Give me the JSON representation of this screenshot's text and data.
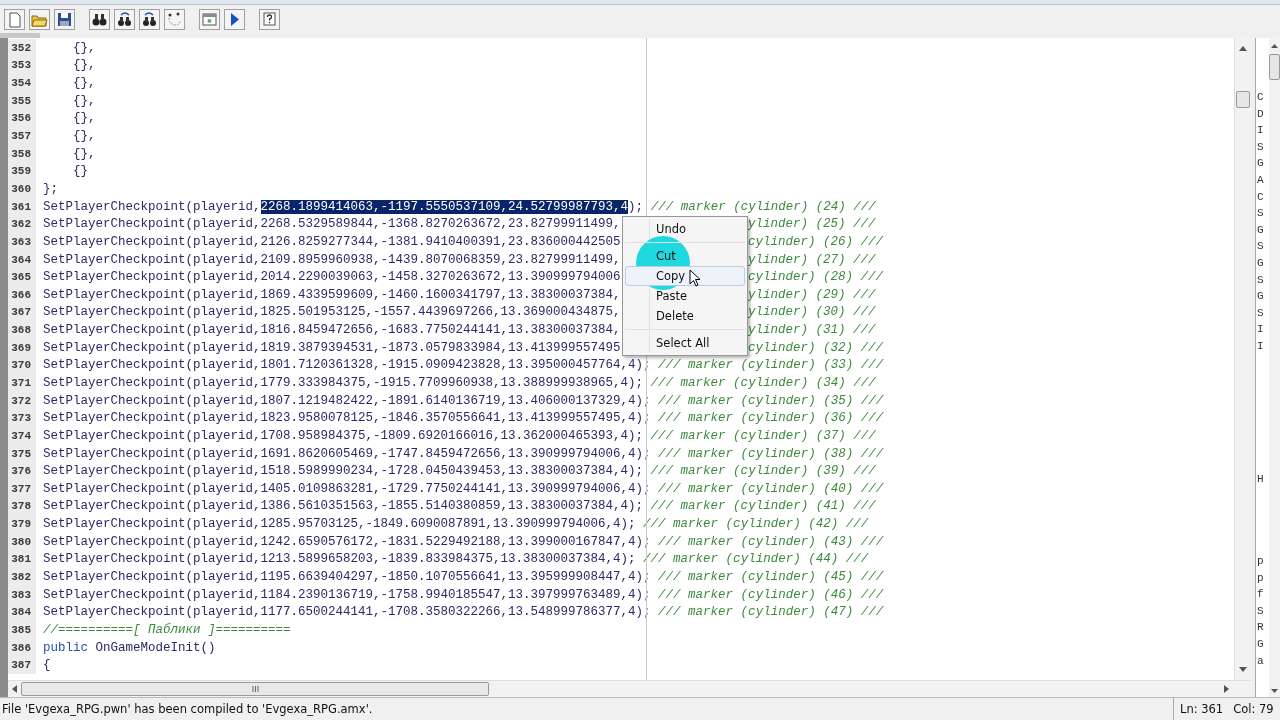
{
  "editor": {
    "lines": [
      {
        "number": "352",
        "parts": [
          {
            "kind": "code",
            "text": "    {},"
          }
        ]
      },
      {
        "number": "353",
        "parts": [
          {
            "kind": "code",
            "text": "    {},"
          }
        ]
      },
      {
        "number": "354",
        "parts": [
          {
            "kind": "code",
            "text": "    {},"
          }
        ]
      },
      {
        "number": "355",
        "parts": [
          {
            "kind": "code",
            "text": "    {},"
          }
        ]
      },
      {
        "number": "356",
        "parts": [
          {
            "kind": "code",
            "text": "    {},"
          }
        ]
      },
      {
        "number": "357",
        "parts": [
          {
            "kind": "code",
            "text": "    {},"
          }
        ]
      },
      {
        "number": "358",
        "parts": [
          {
            "kind": "code",
            "text": "    {},"
          }
        ]
      },
      {
        "number": "359",
        "parts": [
          {
            "kind": "code",
            "text": "    {}"
          }
        ]
      },
      {
        "number": "360",
        "parts": [
          {
            "kind": "code",
            "text": "};"
          }
        ]
      },
      {
        "number": "361",
        "parts": [
          {
            "kind": "code",
            "text": "SetPlayerCheckpoint(playerid,"
          },
          {
            "kind": "selected",
            "text": "2268.1899414063,-1197.5550537109,24.52799987793,4"
          },
          {
            "kind": "code",
            "text": "); "
          },
          {
            "kind": "comment",
            "text": "/// marker (cylinder) (24) ///"
          }
        ]
      },
      {
        "number": "362",
        "parts": [
          {
            "kind": "code",
            "text": "SetPlayerCheckpoint(playerid,2268.5329589844,-1368.8270263672,23.82799911499,"
          }
        ],
        "tail": [
          {
            "kind": "comment",
            "text": "ylinder) (25) ///"
          }
        ]
      },
      {
        "number": "363",
        "parts": [
          {
            "kind": "code",
            "text": "SetPlayerCheckpoint(playerid,2126.8259277344,-1381.9410400391,23.836000442505"
          }
        ],
        "tail": [
          {
            "kind": "comment",
            "text": "cylinder) (26) ///"
          }
        ]
      },
      {
        "number": "364",
        "parts": [
          {
            "kind": "code",
            "text": "SetPlayerCheckpoint(playerid,2109.8959960938,-1439.8070068359,23.82799911499,"
          }
        ],
        "tail": [
          {
            "kind": "comment",
            "text": "ylinder) (27) ///"
          }
        ]
      },
      {
        "number": "365",
        "parts": [
          {
            "kind": "code",
            "text": "SetPlayerCheckpoint(playerid,2014.2290039063,-1458.3270263672,13.390999794006"
          }
        ],
        "tail": [
          {
            "kind": "comment",
            "text": "cylinder) (28) ///"
          }
        ]
      },
      {
        "number": "366",
        "parts": [
          {
            "kind": "code",
            "text": "SetPlayerCheckpoint(playerid,1869.4339599609,-1460.1600341797,13.38300037384,"
          }
        ],
        "tail": [
          {
            "kind": "comment",
            "text": "ylinder) (29) ///"
          }
        ]
      },
      {
        "number": "367",
        "parts": [
          {
            "kind": "code",
            "text": "SetPlayerCheckpoint(playerid,1825.501953125,-1557.4439697266,13.369000434875,"
          }
        ],
        "tail": [
          {
            "kind": "comment",
            "text": "ylinder) (30) ///"
          }
        ]
      },
      {
        "number": "368",
        "parts": [
          {
            "kind": "code",
            "text": "SetPlayerCheckpoint(playerid,1816.8459472656,-1683.7750244141,13.38300037384,"
          }
        ],
        "tail": [
          {
            "kind": "comment",
            "text": "ylinder) (31) ///"
          }
        ]
      },
      {
        "number": "369",
        "parts": [
          {
            "kind": "code",
            "text": "SetPlayerCheckpoint(playerid,1819.3879394531,-1873.0579833984,13.413999557495"
          }
        ],
        "tail": [
          {
            "kind": "comment",
            "text": "cylinder) (32) ///"
          }
        ]
      },
      {
        "number": "370",
        "parts": [
          {
            "kind": "code",
            "text": "SetPlayerCheckpoint(playerid,1801.7120361328,-1915.0909423828,13.395000457764,4); "
          },
          {
            "kind": "comment",
            "text": "/// marker (cylinder) (33) ///"
          }
        ]
      },
      {
        "number": "371",
        "parts": [
          {
            "kind": "code",
            "text": "SetPlayerCheckpoint(playerid,1779.333984375,-1915.7709960938,13.388999938965,4); "
          },
          {
            "kind": "comment",
            "text": "/// marker (cylinder) (34) ///"
          }
        ]
      },
      {
        "number": "372",
        "parts": [
          {
            "kind": "code",
            "text": "SetPlayerCheckpoint(playerid,1807.1219482422,-1891.6140136719,13.406000137329,4); "
          },
          {
            "kind": "comment",
            "text": "/// marker (cylinder) (35) ///"
          }
        ]
      },
      {
        "number": "373",
        "parts": [
          {
            "kind": "code",
            "text": "SetPlayerCheckpoint(playerid,1823.9580078125,-1846.3570556641,13.413999557495,4); "
          },
          {
            "kind": "comment",
            "text": "/// marker (cylinder) (36) ///"
          }
        ]
      },
      {
        "number": "374",
        "parts": [
          {
            "kind": "code",
            "text": "SetPlayerCheckpoint(playerid,1708.958984375,-1809.6920166016,13.362000465393,4); "
          },
          {
            "kind": "comment",
            "text": "/// marker (cylinder) (37) ///"
          }
        ]
      },
      {
        "number": "375",
        "parts": [
          {
            "kind": "code",
            "text": "SetPlayerCheckpoint(playerid,1691.8620605469,-1747.8459472656,13.390999794006,4); "
          },
          {
            "kind": "comment",
            "text": "/// marker (cylinder) (38) ///"
          }
        ]
      },
      {
        "number": "376",
        "parts": [
          {
            "kind": "code",
            "text": "SetPlayerCheckpoint(playerid,1518.5989990234,-1728.0450439453,13.38300037384,4); "
          },
          {
            "kind": "comment",
            "text": "/// marker (cylinder) (39) ///"
          }
        ]
      },
      {
        "number": "377",
        "parts": [
          {
            "kind": "code",
            "text": "SetPlayerCheckpoint(playerid,1405.0109863281,-1729.7750244141,13.390999794006,4); "
          },
          {
            "kind": "comment",
            "text": "/// marker (cylinder) (40) ///"
          }
        ]
      },
      {
        "number": "378",
        "parts": [
          {
            "kind": "code",
            "text": "SetPlayerCheckpoint(playerid,1386.5610351563,-1855.5140380859,13.38300037384,4); "
          },
          {
            "kind": "comment",
            "text": "/// marker (cylinder) (41) ///"
          }
        ]
      },
      {
        "number": "379",
        "parts": [
          {
            "kind": "code",
            "text": "SetPlayerCheckpoint(playerid,1285.95703125,-1849.6090087891,13.390999794006,4); "
          },
          {
            "kind": "comment",
            "text": "/// marker (cylinder) (42) ///"
          }
        ]
      },
      {
        "number": "380",
        "parts": [
          {
            "kind": "code",
            "text": "SetPlayerCheckpoint(playerid,1242.6590576172,-1831.5229492188,13.399000167847,4); "
          },
          {
            "kind": "comment",
            "text": "/// marker (cylinder) (43) ///"
          }
        ]
      },
      {
        "number": "381",
        "parts": [
          {
            "kind": "code",
            "text": "SetPlayerCheckpoint(playerid,1213.5899658203,-1839.833984375,13.38300037384,4); "
          },
          {
            "kind": "comment",
            "text": "/// marker (cylinder) (44) ///"
          }
        ]
      },
      {
        "number": "382",
        "parts": [
          {
            "kind": "code",
            "text": "SetPlayerCheckpoint(playerid,1195.6639404297,-1850.1070556641,13.395999908447,4); "
          },
          {
            "kind": "comment",
            "text": "/// marker (cylinder) (45) ///"
          }
        ]
      },
      {
        "number": "383",
        "parts": [
          {
            "kind": "code",
            "text": "SetPlayerCheckpoint(playerid,1184.2390136719,-1758.9940185547,13.397999763489,4); "
          },
          {
            "kind": "comment",
            "text": "/// marker (cylinder) (46) ///"
          }
        ]
      },
      {
        "number": "384",
        "parts": [
          {
            "kind": "code",
            "text": "SetPlayerCheckpoint(playerid,1177.6500244141,-1708.3580322266,13.548999786377,4); "
          },
          {
            "kind": "comment",
            "text": "/// marker (cylinder) (47) ///"
          }
        ]
      },
      {
        "number": "385",
        "parts": [
          {
            "kind": "comment",
            "text": "//==========[ Паблики ]=========="
          }
        ]
      },
      {
        "number": "386",
        "parts": [
          {
            "kind": "keyword",
            "text": "public"
          },
          {
            "kind": "code",
            "text": " OnGameModeInit()"
          }
        ]
      },
      {
        "number": "387",
        "parts": [
          {
            "kind": "code",
            "text": "{"
          }
        ]
      }
    ]
  },
  "context_menu": {
    "groups": [
      [
        {
          "label": "Undo",
          "selected": false
        }
      ],
      [
        {
          "label": "Cut",
          "selected": false
        },
        {
          "label": "Copy",
          "selected": true
        },
        {
          "label": "Paste",
          "selected": false
        },
        {
          "label": "Delete",
          "selected": false
        }
      ],
      [
        {
          "label": "Select All",
          "selected": false
        }
      ]
    ]
  },
  "side_panel": {
    "groups": [
      [
        "C",
        "D",
        "I",
        "S",
        "G",
        "A",
        "C",
        "S",
        "G",
        "S",
        "G",
        "S",
        "G",
        "S",
        "I",
        "I"
      ],
      [
        "H"
      ],
      [
        "p",
        "p",
        "f",
        "S",
        "R",
        "G",
        "a"
      ]
    ]
  },
  "status_bar": {
    "message": "File 'Evgexa_RPG.pwn' has been compiled to 'Evgexa_RPG.amx'.",
    "line": "Ln: 361",
    "column": "Col: 79"
  }
}
